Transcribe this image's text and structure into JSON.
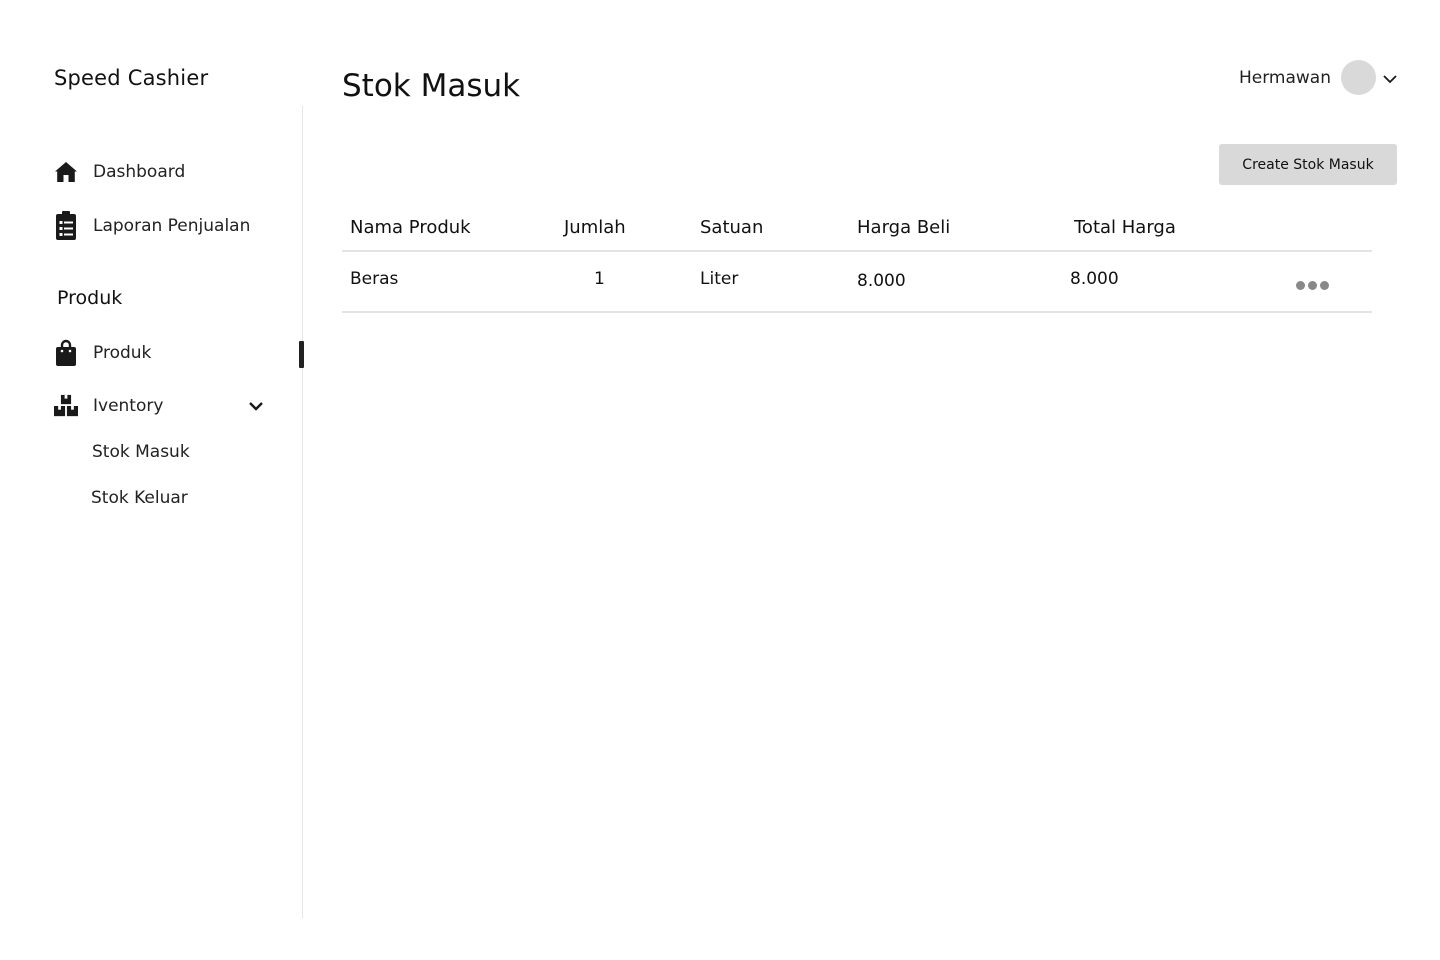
{
  "app": {
    "brand": "Speed Cashier"
  },
  "sidebar": {
    "dashboard": "Dashboard",
    "laporan": "Laporan Penjualan",
    "section": "Produk",
    "produk": "Produk",
    "inventory": "Iventory",
    "sub_items": [
      "Stok Masuk",
      "Stok Keluar"
    ]
  },
  "header": {
    "title": "Stok Masuk",
    "user_name": "Hermawan"
  },
  "toolbar": {
    "create_label": "Create Stok Masuk"
  },
  "table": {
    "columns": [
      "Nama Produk",
      "Jumlah",
      "Satuan",
      "Harga Beli",
      "Total Harga"
    ],
    "rows": [
      [
        "Beras",
        "1",
        "Liter",
        "8.000",
        "8.000"
      ]
    ]
  },
  "colors": {
    "avatar": "#d9d9d9",
    "button": "#d9d9d9",
    "active_marker": "#222222",
    "divider": "#e3e3e3"
  }
}
